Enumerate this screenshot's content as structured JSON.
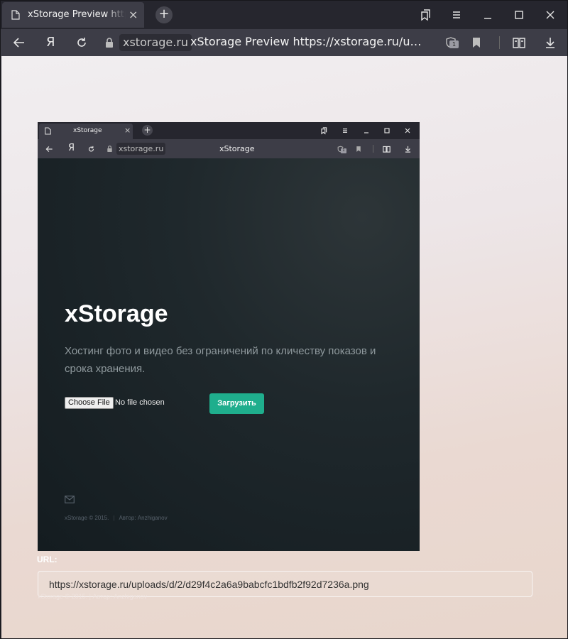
{
  "browser": {
    "tab_title": "xStorage Preview https://xstorage.ru/uploads/d/2/d29f4c2a6a9babcfc1bdfb2f92d7236a.png",
    "new_tab_symbol": "+",
    "tab_close_symbol": "×",
    "yandex_letter": "Я",
    "domain": "xstorage.ru",
    "address_title": "xStorage Preview https://xstorage.ru/uploads/d/2/d29f4c2a6a9babcfc1bdfb2f92d7236a.png",
    "protect_badge": "1"
  },
  "preview": {
    "browser": {
      "tab_title": "xStorage",
      "new_tab_symbol": "+",
      "tab_close_symbol": "×",
      "yandex_letter": "Я",
      "domain": "xstorage.ru",
      "address_title": "xStorage",
      "protect_badge": "1"
    },
    "hero_title": "xStorage",
    "hero_subtitle": "Хостинг фото и видео без ограничений по кличеству показов и срока хранения.",
    "file_button": "Choose File",
    "file_status": "No file chosen",
    "upload_button": "Загрузить",
    "footer_copyright": "xStorage © 2015.",
    "footer_separator": "|",
    "footer_author": "Автор: Anzhiganov"
  },
  "result": {
    "url_label": "URL:",
    "url_value": "https://xstorage.ru/uploads/d/2/d29f4c2a6a9babcfc1bdfb2f92d7236a.png",
    "ghost_footer": "xStorage © 2015.  |  Автор: Anzhiganov"
  },
  "colors": {
    "accent": "#1fae8d",
    "chrome_dark": "#26262e",
    "chrome": "#3d3d47"
  },
  "icons": [
    "page-icon",
    "close-icon",
    "plus-icon",
    "collections-icon",
    "menu-icon",
    "minimize-icon",
    "maximize-icon",
    "window-close-icon",
    "back-icon",
    "reload-icon",
    "lock-icon",
    "protect-icon",
    "bookmark-icon",
    "reader-icon",
    "download-icon",
    "mail-icon"
  ]
}
